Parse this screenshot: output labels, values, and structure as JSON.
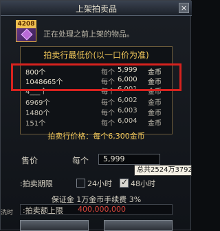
{
  "window": {
    "title": "上架拍卖品"
  },
  "item": {
    "badge": "4208",
    "status_text": "正在处理之前上架的物品。"
  },
  "market": {
    "header": "拍卖行最低价(以一口价为准)",
    "rows": [
      {
        "qty": "800个",
        "per": "每个",
        "price": "5,999",
        "unit": "金币"
      },
      {
        "qty": "1048665个",
        "per": "每个",
        "price": "6,000",
        "unit": "金币"
      },
      {
        "qty": "4___个",
        "per": "每个",
        "price": "6,001",
        "unit": "金币"
      },
      {
        "qty": "6969个",
        "per": "每个",
        "price": "6,002",
        "unit": "金币"
      },
      {
        "qty": "1480个",
        "per": "每个",
        "price": "6,003",
        "unit": "金币"
      },
      {
        "qty": "151个",
        "per": "每个",
        "price": "6,004",
        "unit": "金币"
      }
    ],
    "auction_price": "拍卖行价格：每个6,300金币"
  },
  "form": {
    "price_label": "售价",
    "each_label": "每个",
    "price_value": "5,999",
    "tooltip": "总共2524万3792",
    "period_label": ":拍卖期限",
    "opt24": "24小时",
    "opt48": "48小时",
    "fee_text": "保证金 1万金币手续费 3%",
    "limit_label": ":拍卖额上限",
    "limit_value": "400,000,000",
    "left_edge": "洗时"
  },
  "colors": {
    "accent": "#f2c85a",
    "highlight": "#d8221e",
    "limit": "#e0473d"
  }
}
